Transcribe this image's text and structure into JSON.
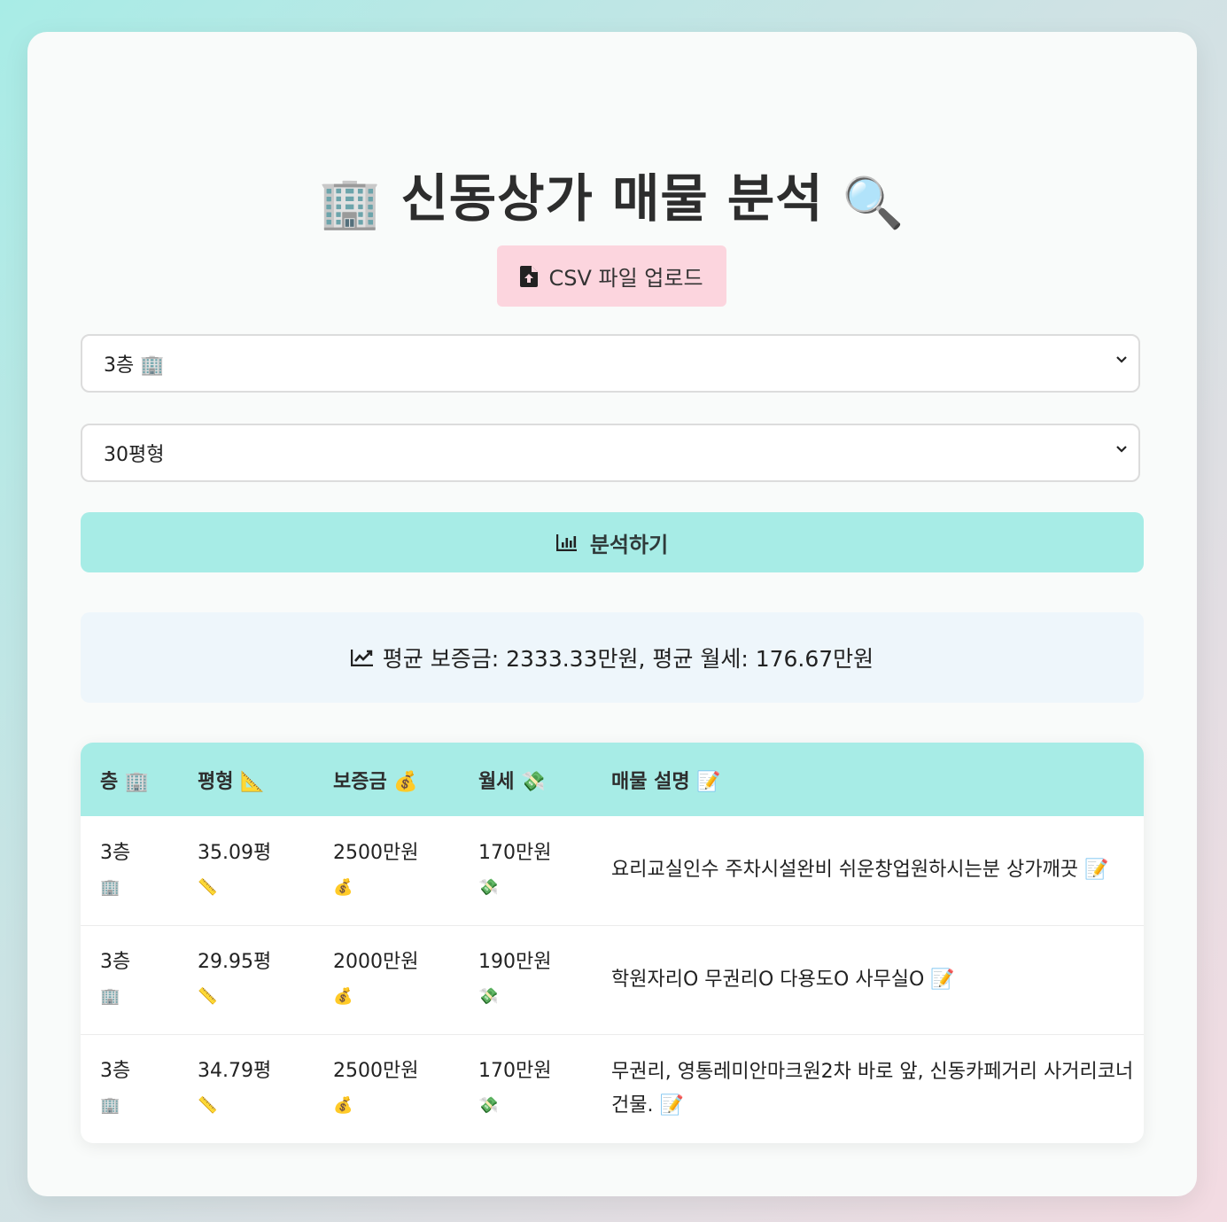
{
  "title": {
    "left_emoji": "🏢",
    "text": "신동상가 매물 분석",
    "right_emoji": "🔍"
  },
  "upload": {
    "icon": "file-upload-icon",
    "label": "CSV 파일 업로드"
  },
  "filters": {
    "floor_select": "3층 🏢",
    "size_select": "30평형"
  },
  "analyze": {
    "icon": "bar-chart-icon",
    "label": "분석하기"
  },
  "summary": {
    "icon": "line-chart-icon",
    "text": "평균 보증금: 2333.33만원, 평균 월세: 176.67만원"
  },
  "table": {
    "headers": [
      "층 🏢",
      "평형 📐",
      "보증금 💰",
      "월세 💸",
      "매물 설명 📝"
    ],
    "rows": [
      {
        "floor": "3층",
        "floor_emoji": "🏢",
        "size": "35.09평",
        "size_emoji": "📏",
        "deposit": "2500만원",
        "deposit_emoji": "💰",
        "rent": "170만원",
        "rent_emoji": "💸",
        "desc": "요리교실인수 주차시설완비 쉬운창업원하시는분 상가깨끗 📝"
      },
      {
        "floor": "3층",
        "floor_emoji": "🏢",
        "size": "29.95평",
        "size_emoji": "📏",
        "deposit": "2000만원",
        "deposit_emoji": "💰",
        "rent": "190만원",
        "rent_emoji": "💸",
        "desc": "학원자리O 무권리O 다용도O 사무실O 📝"
      },
      {
        "floor": "3층",
        "floor_emoji": "🏢",
        "size": "34.79평",
        "size_emoji": "📏",
        "deposit": "2500만원",
        "deposit_emoji": "💰",
        "rent": "170만원",
        "rent_emoji": "💸",
        "desc": "무권리, 영통레미안마크원2차 바로 앞, 신동카페거리 사거리코너 건물. 📝"
      }
    ]
  }
}
